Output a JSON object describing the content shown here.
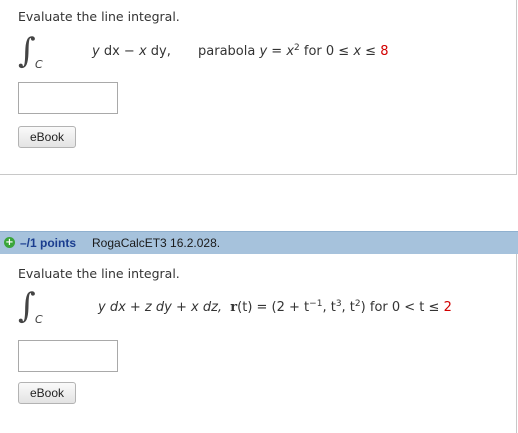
{
  "question1": {
    "prompt": "Evaluate the line integral.",
    "integral_sign": "∫",
    "subscript": "C",
    "integrand": {
      "y": "y",
      "dx": " dx − ",
      "x": "x",
      "dy": " dy,"
    },
    "curve": {
      "label": "parabola  ",
      "y": "y",
      "eq": " = ",
      "x": "x",
      "exp": "2",
      "for": "  for  0 ≤ ",
      "var": "x",
      "le": " ≤ ",
      "upper": "8"
    },
    "ebook_label": "eBook"
  },
  "question2": {
    "header": {
      "points": "–/1 points",
      "id": "RogaCalcET3 16.2.028."
    },
    "prompt": "Evaluate the line integral.",
    "integral_sign": "∫",
    "subscript": "C",
    "integrand": "y dx + z dy + x dz,",
    "r": "r",
    "param": "(t) = (2 + t",
    "exp1": "−1",
    "mid": ", t",
    "exp2": "3",
    "mid2": ", t",
    "exp3": "2",
    "close": ")",
    "for": "  for  0 < t ≤ ",
    "upper": "2",
    "ebook_label": "eBook"
  },
  "colors": {
    "accent_red": "#d20000",
    "header_bar": "#a6c2dc",
    "points_blue": "#1a3d8f",
    "plus_green": "#3aa53a"
  }
}
